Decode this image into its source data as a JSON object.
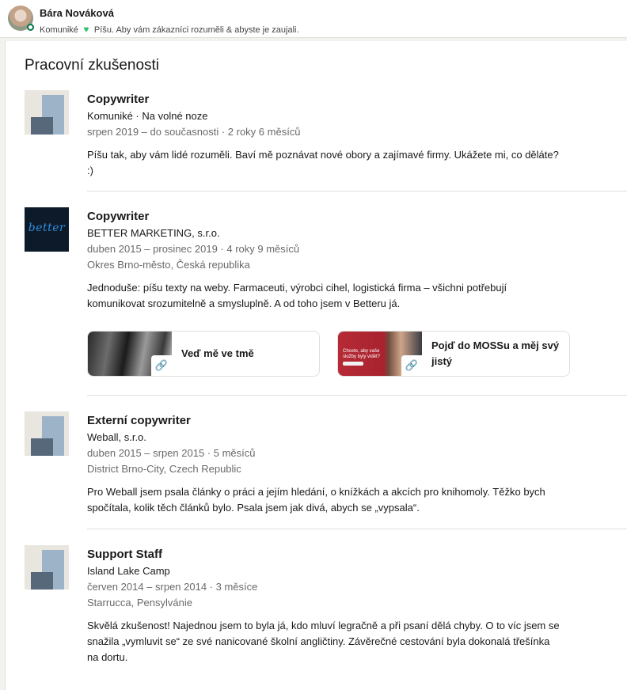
{
  "topbar": {
    "name": "Bára Nováková",
    "headline_company": "Komuniké",
    "headline_text": "Píšu. Aby vám zákazníci rozuměli & abyste je zaujali."
  },
  "section": {
    "title": "Pracovní zkušenosti"
  },
  "experiences": [
    {
      "title": "Copywriter",
      "company": "Komuniké · Na volné noze",
      "dates": "srpen 2019 – do současnosti · 2 roky 6 měsíců",
      "location": "",
      "description": "Píšu tak, aby vám lidé rozuměli. Baví mě poznávat nové obory a zajímavé firmy. Ukážete mi, co děláte? :)"
    },
    {
      "title": "Copywriter",
      "company": "BETTER MARKETING, s.r.o.",
      "dates": "duben 2015 – prosinec 2019 · 4 roky 9 měsíců",
      "location": "Okres Brno-město, Česká republika",
      "description": "Jednoduše: píšu texty na weby. Farmaceuti, výrobci cihel, logistická firma – všichni potřebují komunikovat srozumitelně a smysluplně. A od toho jsem v Betteru já.",
      "logo_text": "better",
      "media": [
        {
          "label": "Veď mě ve tmě",
          "thumb_text": ""
        },
        {
          "label": "Pojď do MOSSu a měj svý jistý",
          "thumb_text": "Chcete, aby vaše služby byly vidět?"
        }
      ]
    },
    {
      "title": "Externí copywriter",
      "company": "Weball, s.r.o.",
      "dates": "duben 2015 – srpen 2015 · 5 měsíců",
      "location": "District Brno-City, Czech Republic",
      "description": "Pro Weball jsem psala články o práci a jejím hledání, o knížkách a akcích pro knihomoly. Těžko bych spočítala, kolik těch článků bylo. Psala jsem jak divá, abych se „vypsala“."
    },
    {
      "title": "Support Staff",
      "company": "Island Lake Camp",
      "dates": "červen 2014 – srpen 2014 · 3 měsíce",
      "location": "Starrucca, Pensylvánie",
      "description": "Skvělá zkušenost! Najednou jsem to byla já, kdo mluví legračně a při psaní dělá chyby. O to víc jsem se snažila „vymluvit se“ ze své nanicované školní angličtiny. Závěrečné cestování byla dokonalá třešínka na dortu."
    }
  ],
  "colors": {
    "presence": "#057642",
    "heart": "#2fc470",
    "page_bg": "#f3f2ef",
    "divider": "#e0dfdc"
  },
  "icons": [
    "heart-icon",
    "link-icon",
    "presence-indicator-icon"
  ]
}
